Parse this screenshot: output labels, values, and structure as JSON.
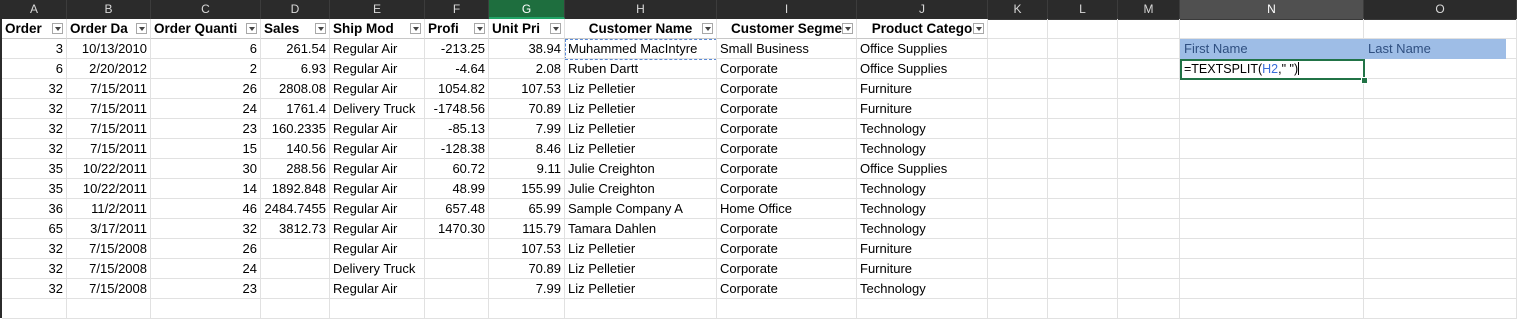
{
  "columns": [
    "A",
    "B",
    "C",
    "D",
    "E",
    "F",
    "G",
    "H",
    "I",
    "J",
    "K",
    "L",
    "M",
    "N",
    "O"
  ],
  "headers": [
    "Order",
    "Order Da",
    "Order Quanti",
    "Sales",
    "Ship Mod",
    "Profi",
    "Unit Pri",
    "Customer Name",
    "Customer Segme",
    "Product Catego"
  ],
  "rows": [
    [
      "3",
      "10/13/2010",
      "6",
      "261.54",
      "Regular Air",
      "-213.25",
      "38.94",
      "Muhammed MacIntyre",
      "Small Business",
      "Office Supplies"
    ],
    [
      "6",
      "2/20/2012",
      "2",
      "6.93",
      "Regular Air",
      "-4.64",
      "2.08",
      "Ruben Dartt",
      "Corporate",
      "Office Supplies"
    ],
    [
      "32",
      "7/15/2011",
      "26",
      "2808.08",
      "Regular Air",
      "1054.82",
      "107.53",
      "Liz Pelletier",
      "Corporate",
      "Furniture"
    ],
    [
      "32",
      "7/15/2011",
      "24",
      "1761.4",
      "Delivery Truck",
      "-1748.56",
      "70.89",
      "Liz Pelletier",
      "Corporate",
      "Furniture"
    ],
    [
      "32",
      "7/15/2011",
      "23",
      "160.2335",
      "Regular Air",
      "-85.13",
      "7.99",
      "Liz Pelletier",
      "Corporate",
      "Technology"
    ],
    [
      "32",
      "7/15/2011",
      "15",
      "140.56",
      "Regular Air",
      "-128.38",
      "8.46",
      "Liz Pelletier",
      "Corporate",
      "Technology"
    ],
    [
      "35",
      "10/22/2011",
      "30",
      "288.56",
      "Regular Air",
      "60.72",
      "9.11",
      "Julie Creighton",
      "Corporate",
      "Office Supplies"
    ],
    [
      "35",
      "10/22/2011",
      "14",
      "1892.848",
      "Regular Air",
      "48.99",
      "155.99",
      "Julie Creighton",
      "Corporate",
      "Technology"
    ],
    [
      "36",
      "11/2/2011",
      "46",
      "2484.7455",
      "Regular Air",
      "657.48",
      "65.99",
      "Sample Company A",
      "Home Office",
      "Technology"
    ],
    [
      "65",
      "3/17/2011",
      "32",
      "3812.73",
      "Regular Air",
      "1470.30",
      "115.79",
      "Tamara Dahlen",
      "Corporate",
      "Technology"
    ],
    [
      "32",
      "7/15/2008",
      "26",
      "",
      "Regular Air",
      "",
      "107.53",
      "Liz Pelletier",
      "Corporate",
      "Furniture"
    ],
    [
      "32",
      "7/15/2008",
      "24",
      "",
      "Delivery Truck",
      "",
      "70.89",
      "Liz Pelletier",
      "Corporate",
      "Furniture"
    ],
    [
      "32",
      "7/15/2008",
      "23",
      "",
      "Regular Air",
      "",
      "7.99",
      "Liz Pelletier",
      "Corporate",
      "Technology"
    ]
  ],
  "side": {
    "first_name": "First Name",
    "last_name": "Last Name",
    "formula_prefix": "=TEXTSPLIT(",
    "formula_ref": "H2",
    "formula_suffix": ",\" \")"
  },
  "colors": {
    "header_bg": "#2b2b2b",
    "selected_col_bg": "#1e6e3e",
    "name_header_bg": "#9ebde6",
    "active_border": "#217346"
  }
}
